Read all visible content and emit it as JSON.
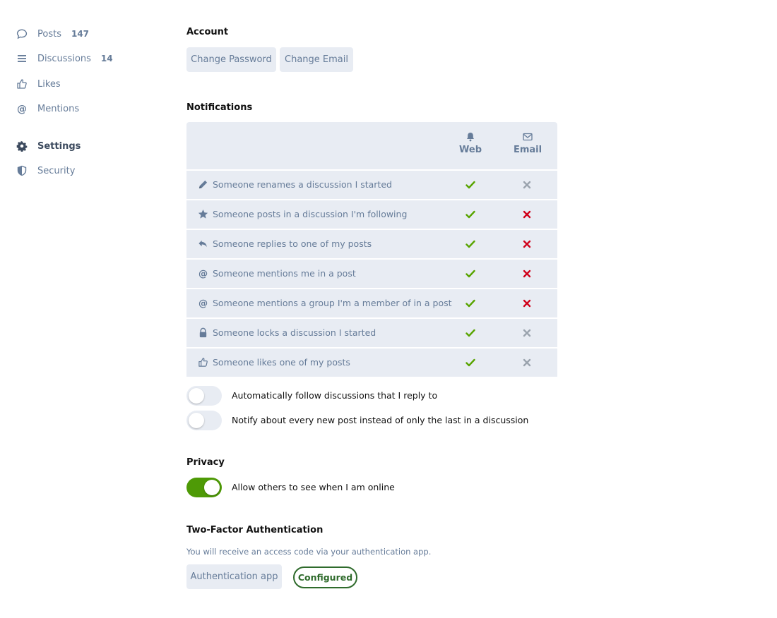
{
  "sidebar": {
    "items": [
      {
        "label": "Posts",
        "count": "147",
        "icon": "comment-icon"
      },
      {
        "label": "Discussions",
        "count": "14",
        "icon": "list-icon"
      },
      {
        "label": "Likes",
        "count": "",
        "icon": "thumbs-up-icon"
      },
      {
        "label": "Mentions",
        "count": "",
        "icon": "at-icon"
      },
      {
        "label": "Settings",
        "count": "",
        "icon": "gear-icon",
        "active": true
      },
      {
        "label": "Security",
        "count": "",
        "icon": "shield-icon"
      }
    ]
  },
  "account": {
    "title": "Account",
    "change_password": "Change Password",
    "change_email": "Change Email"
  },
  "notifications": {
    "title": "Notifications",
    "columns": {
      "web": "Web",
      "email": "Email"
    },
    "rows": [
      {
        "label": "Someone renames a discussion I started",
        "icon": "pencil-icon",
        "web": "check",
        "email": "x-disabled"
      },
      {
        "label": "Someone posts in a discussion I'm following",
        "icon": "star-icon",
        "web": "check",
        "email": "x-red"
      },
      {
        "label": "Someone replies to one of my posts",
        "icon": "reply-icon",
        "web": "check",
        "email": "x-red"
      },
      {
        "label": "Someone mentions me in a post",
        "icon": "at-icon",
        "web": "check",
        "email": "x-red"
      },
      {
        "label": "Someone mentions a group I'm a member of in a post",
        "icon": "at-icon",
        "web": "check",
        "email": "x-red"
      },
      {
        "label": "Someone locks a discussion I started",
        "icon": "lock-icon",
        "web": "check",
        "email": "x-disabled"
      },
      {
        "label": "Someone likes one of my posts",
        "icon": "thumbs-up-icon",
        "web": "check",
        "email": "x-disabled"
      }
    ],
    "toggles": [
      {
        "label": "Automatically follow discussions that I reply to",
        "on": false
      },
      {
        "label": "Notify about every new post instead of only the last in a discussion",
        "on": false
      }
    ]
  },
  "privacy": {
    "title": "Privacy",
    "toggle_label": "Allow others to see when I am online",
    "on": true
  },
  "two_factor": {
    "title": "Two-Factor Authentication",
    "hint": "You will receive an access code via your authentication app.",
    "button": "Authentication app",
    "status": "Configured"
  },
  "colors": {
    "accent_green": "#4e9a06",
    "check_green": "#58a400",
    "x_red": "#d0021b",
    "x_gray": "#9aa3ad",
    "muted": "#667c99",
    "panel": "#e8ecf3",
    "configured": "#2f6b2c"
  }
}
